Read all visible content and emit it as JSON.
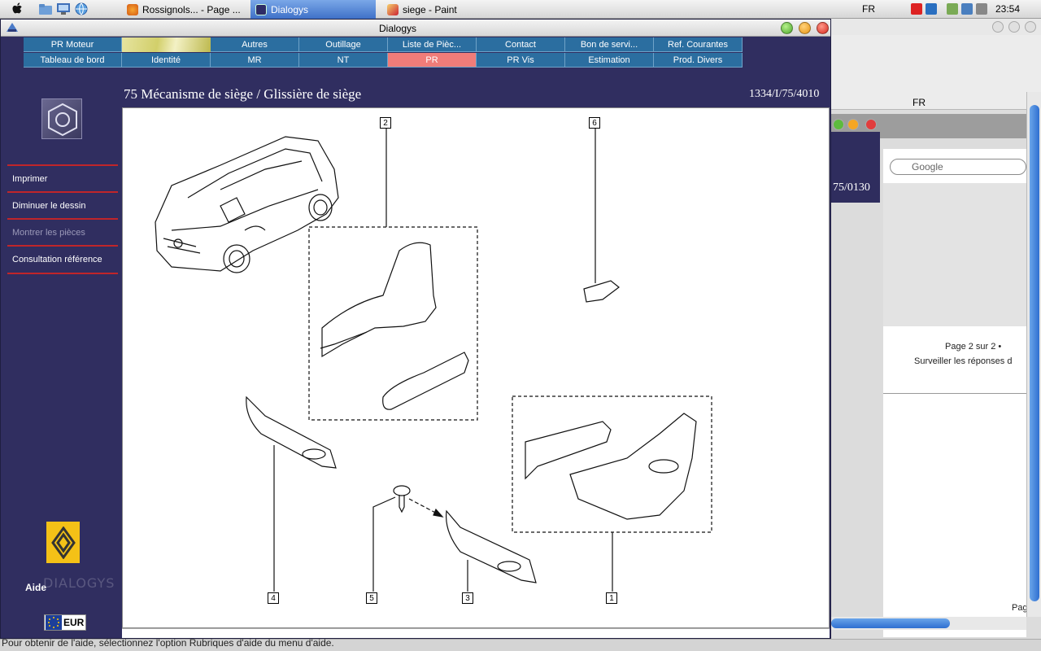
{
  "taskbar": {
    "tasks": [
      {
        "label": "Rossignols... - Page ..."
      },
      {
        "label": "Dialogys"
      },
      {
        "label": "siege - Paint"
      }
    ],
    "language": "FR",
    "clock": "23:54"
  },
  "background_browser": {
    "language": "FR",
    "ref_fragment": "75/0130",
    "search_placeholder": "Google",
    "page_info": "Page 2 sur 2 •",
    "watch_replies": "Surveiller les réponses d",
    "page_fragment": "Pag"
  },
  "app": {
    "title": "Dialogys",
    "menu_row1": [
      "PR Moteur",
      "",
      "Autres",
      "Outillage",
      "Liste de Pièc...",
      "Contact",
      "Bon de servi...",
      "Ref. Courantes"
    ],
    "menu_row2": [
      "Tableau de bord",
      "Identité",
      "MR",
      "NT",
      "PR",
      "PR Vis",
      "Estimation",
      "Prod. Divers"
    ],
    "active_menu": "PR",
    "sidebar": {
      "links": [
        {
          "label": "Imprimer",
          "enabled": true
        },
        {
          "label": "Diminuer le dessin",
          "enabled": true
        },
        {
          "label": "Montrer les pièces",
          "enabled": false
        },
        {
          "label": "Consultation référence",
          "enabled": true
        }
      ],
      "brand": "DIALOGYS",
      "help": "Aide",
      "currency": "EUR"
    },
    "page_title": "75 Mécanisme de siège / Glissière de siège",
    "reference": "1334/I/75/4010",
    "callouts": [
      "1",
      "2",
      "3",
      "4",
      "5",
      "6"
    ]
  },
  "status_bar": "Pour obtenir de l'aide, sélectionnez l'option Rubriques d'aide du menu d'aide.",
  "colors": {
    "app_background": "#302e60",
    "menu_cell": "#2b6ea0",
    "menu_active": "#f07c79",
    "sidebar_divider": "#c0252a"
  }
}
